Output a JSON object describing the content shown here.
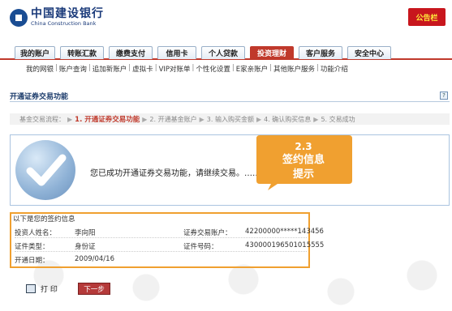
{
  "header": {
    "logo_cn": "中国建设银行",
    "logo_en": "China Construction Bank",
    "notice_label": "公告栏"
  },
  "nav": {
    "tabs": [
      {
        "label": "我的账户"
      },
      {
        "label": "转账汇款"
      },
      {
        "label": "缴费支付"
      },
      {
        "label": "信用卡"
      },
      {
        "label": "个人贷款"
      },
      {
        "label": "投资理财",
        "active": true
      },
      {
        "label": "客户服务"
      },
      {
        "label": "安全中心"
      }
    ],
    "subnav": [
      "我的网银",
      "账户查询",
      "追加新账户",
      "虚拟卡",
      "VIP对账单",
      "个性化设置",
      "E家亲账户",
      "其他账户服务",
      "功能介绍"
    ]
  },
  "section": {
    "title": "开通证券交易功能",
    "icon": "?"
  },
  "steps": {
    "prefix": "基金交易流程：",
    "items": [
      {
        "label": "1. 开通证券交易功能",
        "current": true
      },
      {
        "label": "2. 开通基金账户"
      },
      {
        "label": "3. 输入购买金额"
      },
      {
        "label": "4. 确认购买信息"
      },
      {
        "label": "5. 交易成功"
      }
    ]
  },
  "success": {
    "message": "您已成功开通证券交易功能，请继续交易。……"
  },
  "callout": {
    "line1": "2.3",
    "line2": "签约信息",
    "line3": "提示"
  },
  "info": {
    "heading": "以下是您的签约信息",
    "rows": [
      {
        "label1": "投资人姓名：",
        "value1": "李向阳",
        "label2": "证券交易账户：",
        "value2": "42200000*****143456"
      },
      {
        "label1": "证件类型：",
        "value1": "身份证",
        "label2": "证件号码：",
        "value2": "430000196501015555"
      },
      {
        "label1": "开通日期：",
        "value1": "2009/04/16",
        "label2": "",
        "value2": ""
      }
    ]
  },
  "actions": {
    "print_label": "打 印",
    "next_label": "下一步"
  },
  "colors": {
    "brand": "#1a3a7a",
    "accent": "#c0392b",
    "callout": "#f0a030"
  }
}
